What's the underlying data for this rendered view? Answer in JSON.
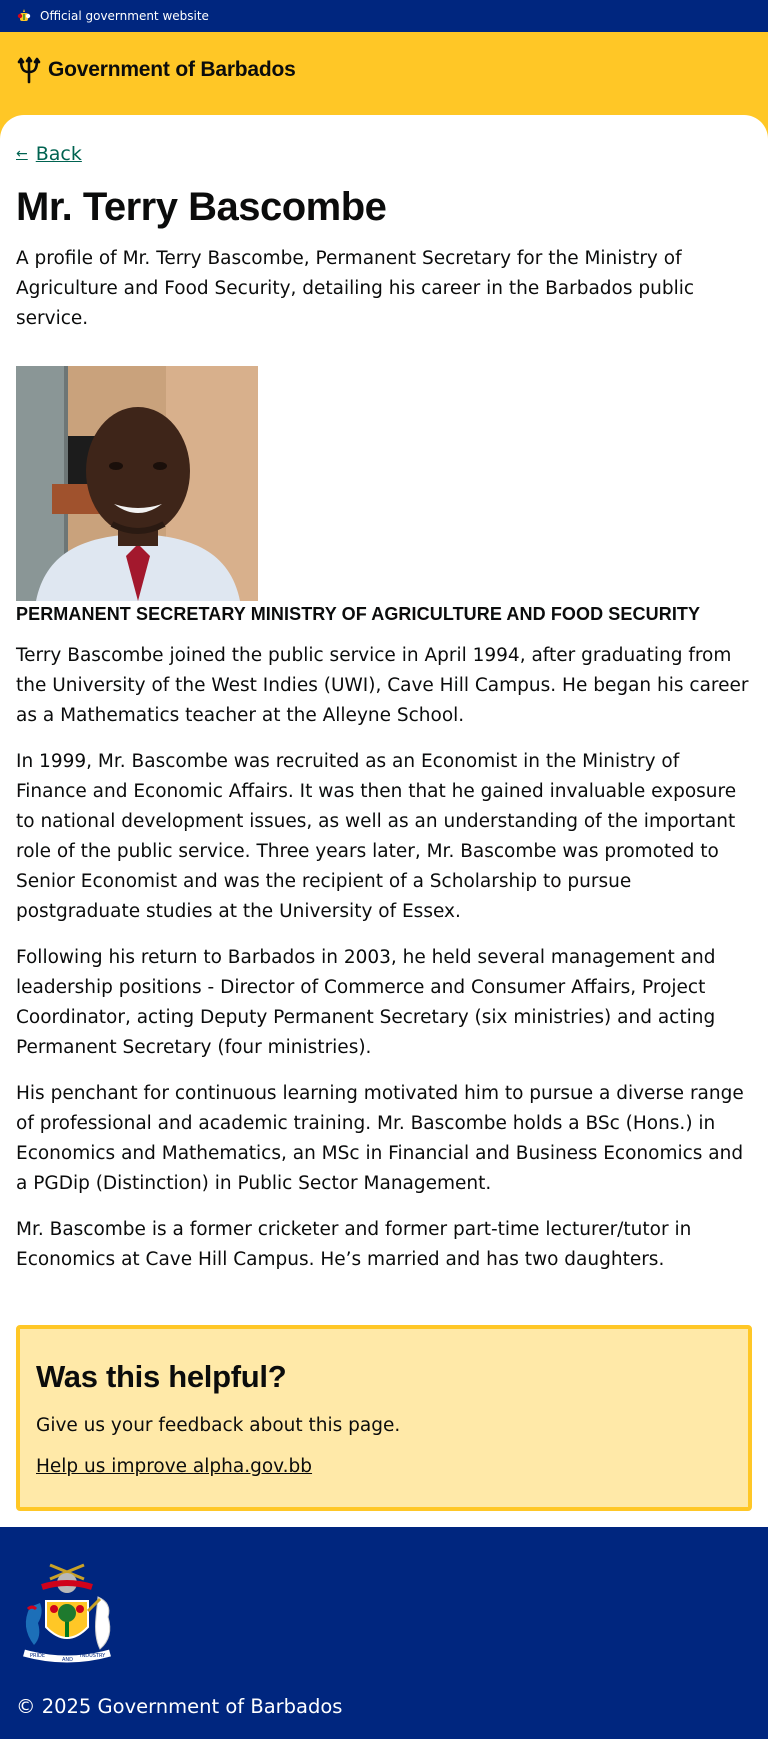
{
  "official_bar": {
    "text": "Official government website",
    "icon": "barbados-crest-icon"
  },
  "header": {
    "brand_title": "Government of Barbados",
    "icon": "trident-icon",
    "color": "#ffc726"
  },
  "nav": {
    "back_label": "Back",
    "back_icon": "arrow-left-icon"
  },
  "page": {
    "title": "Mr. Terry Bascombe",
    "lede": "A profile of Mr. Terry Bascombe, Permanent Secretary for the Ministry of Agriculture and Food Security, detailing his career in the Barbados public service.",
    "role_heading": "PERMANENT SECRETARY MINISTRY OF AGRICULTURE AND FOOD SECURITY",
    "paragraphs": [
      "Terry Bascombe joined the public service in April 1994, after graduating from the University of the West Indies (UWI), Cave Hill Campus. He began his career as a Mathematics teacher at the Alleyne School.",
      "In 1999, Mr. Bascombe was recruited as an Economist in the Ministry of Finance and Economic Affairs. It was then that he gained invaluable exposure to national development issues, as well as an understanding of the important role of the public service. Three years later, Mr. Bascombe was promoted to Senior Economist and was the recipient of a Scholarship to pursue postgraduate studies at the University of Essex.",
      "Following his return to Barbados in 2003, he held several management and leadership positions - Director of Commerce and Consumer Affairs, Project Coordinator, acting Deputy Permanent Secretary (six ministries) and acting Permanent Secretary (four ministries).",
      "His penchant for continuous learning motivated him to pursue a diverse range of professional and academic training. Mr. Bascombe holds a BSc (Hons.) in Economics and Mathematics, an MSc in Financial and Business Economics and a PGDip (Distinction) in Public Sector Management.",
      "Mr. Bascombe is a former cricketer and former part-time lecturer/tutor in Economics at Cave Hill Campus. He’s married and has two daughters."
    ]
  },
  "feedback": {
    "heading": "Was this helpful?",
    "text": "Give us your feedback about this page.",
    "link_label": "Help us improve alpha.gov.bb"
  },
  "footer": {
    "copyright": "© 2025 Government of Barbados",
    "coat_of_arms_motto_left": "PRIDE",
    "coat_of_arms_motto_mid": "AND",
    "coat_of_arms_motto_right": "INDUSTRY",
    "color": "#00267f"
  }
}
